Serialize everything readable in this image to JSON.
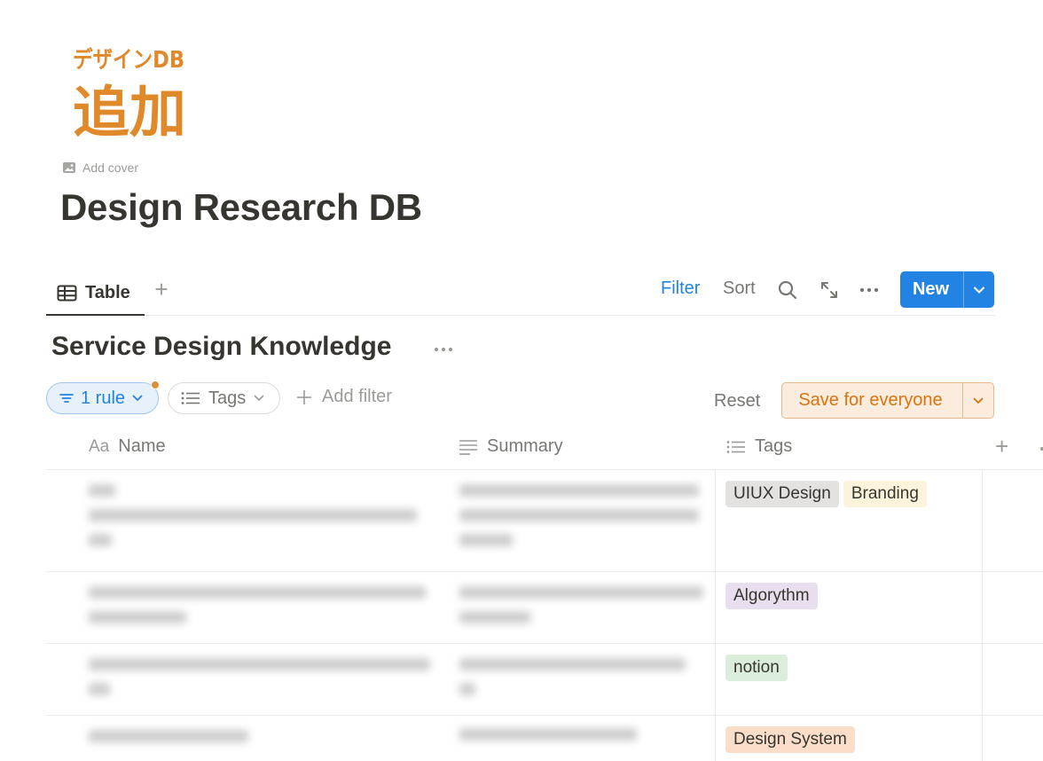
{
  "logo": {
    "line1": "デザインDB",
    "line2": "追加",
    "color": "#e0892a"
  },
  "header": {
    "add_cover": "Add cover",
    "title": "Design Research DB"
  },
  "viewbar": {
    "tab_label": "Table",
    "add_view": "+",
    "filter": "Filter",
    "sort": "Sort",
    "new_label": "New"
  },
  "database": {
    "title": "Service Design Knowledge",
    "rule_chip": "1 rule",
    "tags_chip": "Tags",
    "add_filter": "Add filter",
    "reset": "Reset",
    "save": "Save for everyone"
  },
  "columns": {
    "name": "Name",
    "name_prefix": "Aa",
    "summary": "Summary",
    "tags": "Tags",
    "add": "+"
  },
  "rows": [
    {
      "tags": [
        {
          "label": "UIUX Design",
          "bg": "#e3e2e0",
          "color": "#37352f"
        },
        {
          "label": "Branding",
          "bg": "#fbf3db",
          "color": "#37352f"
        }
      ]
    },
    {
      "tags": [
        {
          "label": "Algorythm",
          "bg": "#e8deee",
          "color": "#37352f"
        }
      ]
    },
    {
      "tags": [
        {
          "label": "notion",
          "bg": "#dbeddb",
          "color": "#37352f"
        }
      ]
    },
    {
      "tags": [
        {
          "label": "Design System",
          "bg": "#fadec9",
          "color": "#37352f"
        }
      ]
    }
  ],
  "colors": {
    "accent": "#2383e2",
    "save_bg": "#fbecdd",
    "save_fg": "#d9730d"
  }
}
